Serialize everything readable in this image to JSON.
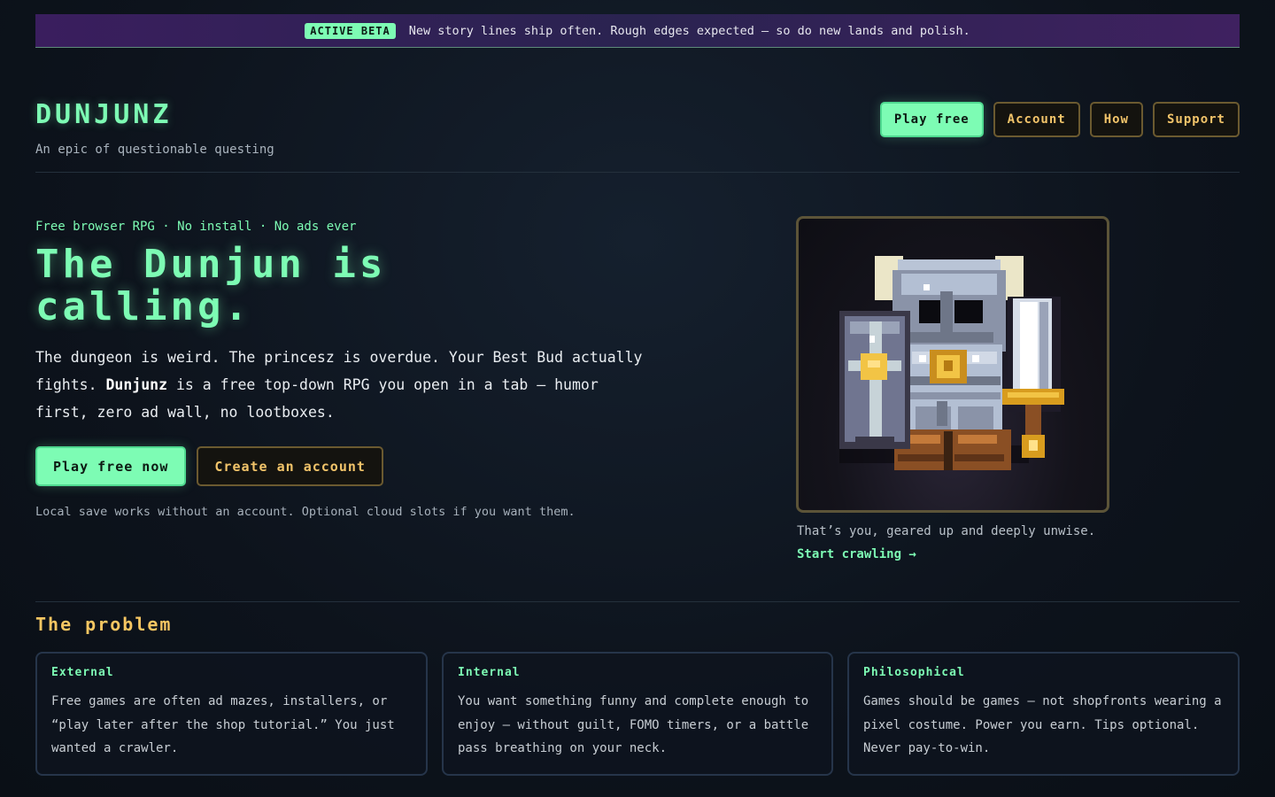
{
  "beta": {
    "badge": "ACTIVE BETA",
    "text": "New story lines ship often. Rough edges expected — so do new lands and polish."
  },
  "header": {
    "brand": "DUNJUNZ",
    "tagline": "An epic of questionable questing",
    "nav": [
      {
        "label": "Play free"
      },
      {
        "label": "Account"
      },
      {
        "label": "How"
      },
      {
        "label": "Support"
      }
    ]
  },
  "hero": {
    "kicker": "Free browser RPG · No install · No ads ever",
    "headline": "The Dunjun is calling.",
    "lede_pre": "The dungeon is weird. The princesz is overdue. Your Best Bud actually fights. ",
    "lede_bold": "Dunjunz",
    "lede_post": " is a free top-down RPG you open in a tab — humor first, zero ad wall, no lootboxes.",
    "cta_primary": "Play free now",
    "cta_secondary": "Create an account",
    "note": "Local save works without an account. Optional cloud slots if you want them."
  },
  "portrait": {
    "icon": "knight-sprite",
    "caption": "That’s you, geared up and deeply unwise.",
    "link": "Start crawling →"
  },
  "problem": {
    "title": "The problem",
    "cards": [
      {
        "title": "External",
        "body": "Free games are often ad mazes, installers, or “play later after the shop tutorial.” You just wanted a crawler."
      },
      {
        "title": "Internal",
        "body": "You want something funny and complete enough to enjoy — without guilt, FOMO timers, or a battle pass breathing on your neck."
      },
      {
        "title": "Philosophical",
        "body": "Games should be games — not shopfronts wearing a pixel costume. Power you earn. Tips optional. Never pay-to-win."
      }
    ]
  },
  "colors": {
    "accent": "#7dfcb4",
    "gold": "#f6c662",
    "background": "#0d131c"
  }
}
